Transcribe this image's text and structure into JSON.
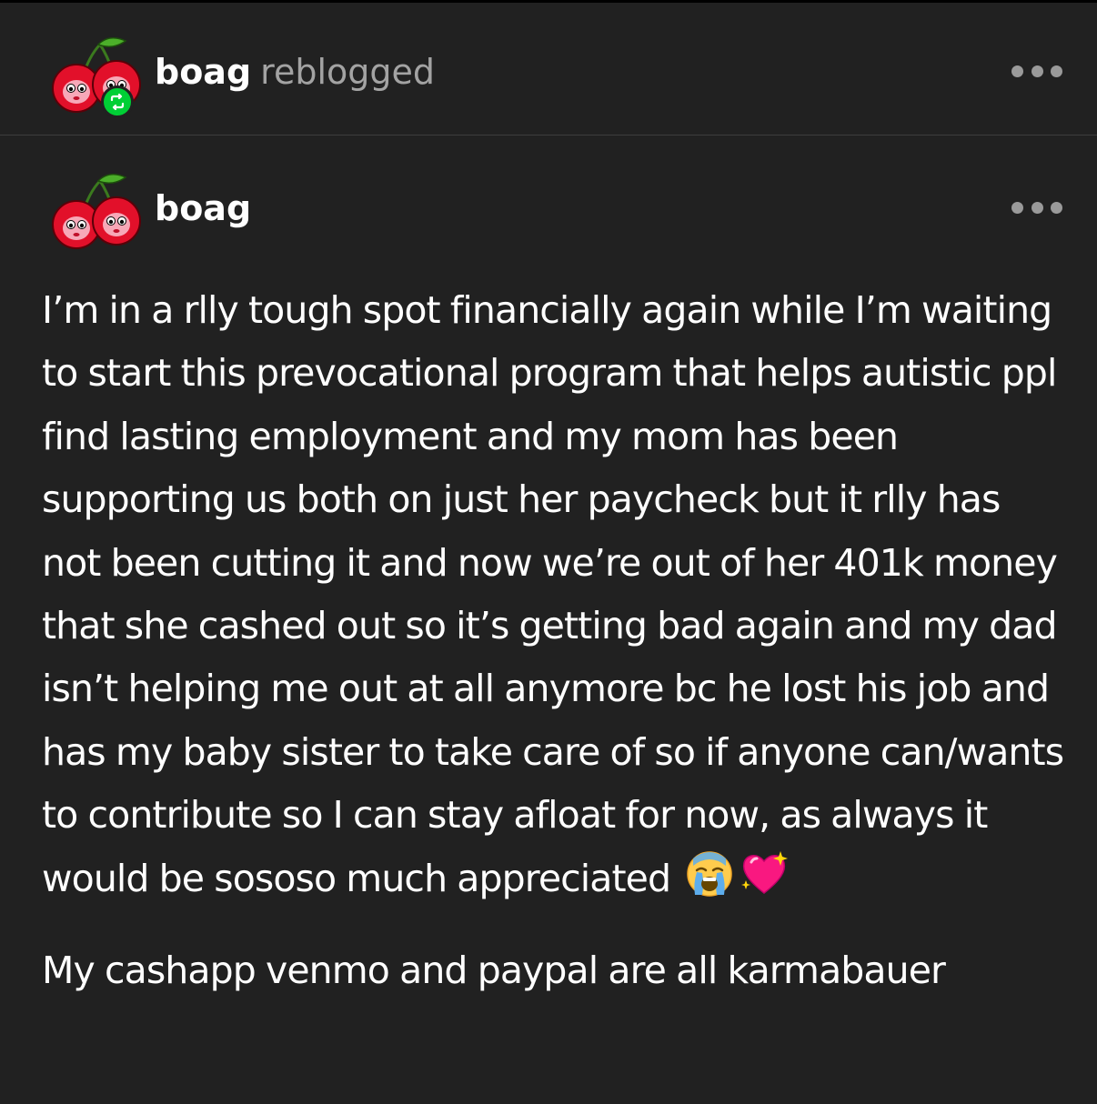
{
  "reblog_header": {
    "username": "boag",
    "action": "reblogged",
    "avatar_icon": "cherry-avatar-icon",
    "badge_icon": "reblog-icon",
    "badge_color": "#00cf35"
  },
  "post_header": {
    "username": "boag",
    "avatar_icon": "cherry-avatar-icon"
  },
  "post": {
    "paragraph_1": "I’m in a rlly tough spot financially again while I’m waiting to start this prevocational program that helps autistic ppl find lasting employment and my mom has been supporting us both on just her paycheck but it rlly has not been cutting it and now we’re out of her 401k money that she cashed out so it’s getting bad again and my dad isn’t helping me out at all anymore bc he lost his job and has my baby sister to take care of so if anyone can/wants to contribute so I can stay afloat for now, as always it would be sososo much appreciated",
    "paragraph_1_emojis": [
      "crying-face-emoji",
      "sparkling-heart-emoji"
    ],
    "paragraph_2": "My cashapp venmo and paypal are all karmabauer"
  },
  "colors": {
    "background": "#212121",
    "text": "#ffffff",
    "secondary_text": "#a3a3a3",
    "divider": "#3d3d3d"
  }
}
